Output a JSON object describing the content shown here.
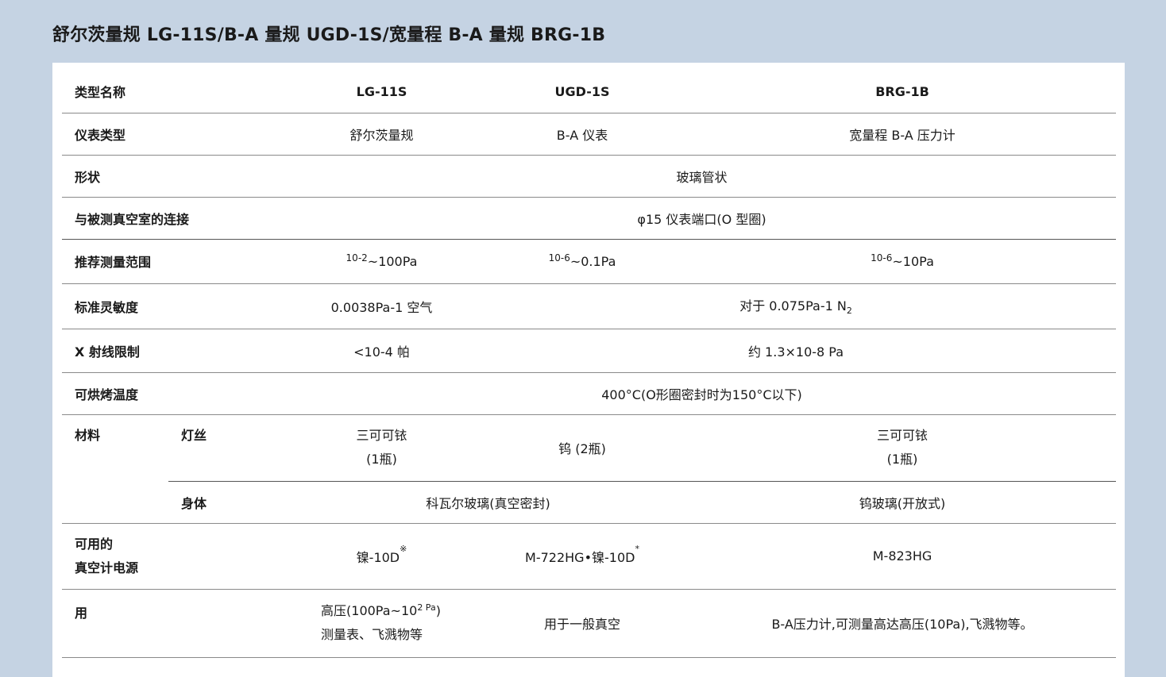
{
  "title": "舒尔茨量规 LG-11S/B-A 量规 UGD-1S/宽量程 B-A 量规 BRG-1B",
  "header": {
    "label": "类型名称",
    "col1": "LG-11S",
    "col2": "UGD-1S",
    "col3": "BRG-1B"
  },
  "rows": {
    "gauge_type": {
      "label": "仪表类型",
      "col1": "舒尔茨量规",
      "col2": "B-A 仪表",
      "col3": "宽量程 B-A 压力计"
    },
    "shape": {
      "label": "形状",
      "value": "玻璃管状"
    },
    "connection": {
      "label": "与被测真空室的连接",
      "value": "φ15 仪表端口(O 型圈)"
    },
    "range": {
      "label": "推荐测量范围",
      "col1_exp": "10-2",
      "col1_rest": "~100Pa",
      "col2_exp": "10-6",
      "col2_rest": "~0.1Pa",
      "col3_exp": "10-6",
      "col3_rest": "~10Pa"
    },
    "sensitivity": {
      "label": "标准灵敏度",
      "col1": "0.0038Pa-1 空气",
      "col23": "对于 0.075Pa-1 N",
      "col23_sub": "2"
    },
    "xray": {
      "label": "X 射线限制",
      "col1": "<10-4 帕",
      "col23": "约 1.3×10-8 Pa"
    },
    "bake": {
      "label": "可烘烤温度",
      "value": "400°C(O形圈密封时为150°C以下)"
    },
    "material": {
      "label": "材料",
      "filament_label": "灯丝",
      "filament_col1_line1": "三可可铱",
      "filament_col1_line2": "(1瓶)",
      "filament_col2": "钨 (2瓶)",
      "filament_col3_line1": "三可可铱",
      "filament_col3_line2": "(1瓶)",
      "body_label": "身体",
      "body_col12": "科瓦尔玻璃(真空密封)",
      "body_col3": "钨玻璃(开放式)"
    },
    "power": {
      "label_line1": "可用的",
      "label_line2": "真空计电源",
      "col1": "镍-10D",
      "col1_mark": "※",
      "col2": "M-722HG•镍-10D",
      "col2_mark": "*",
      "col3": "M-823HG"
    },
    "usage": {
      "label": "用",
      "col1_line1_a": "高压(100Pa~10",
      "col1_line1_sup": "2 Pa",
      "col1_line1_b": ")",
      "col1_line2": "测量表、飞溅物等",
      "col2": "用于一般真空",
      "col3": "B-A压力计,可测量高达高压(10Pa),飞溅物等。"
    }
  }
}
